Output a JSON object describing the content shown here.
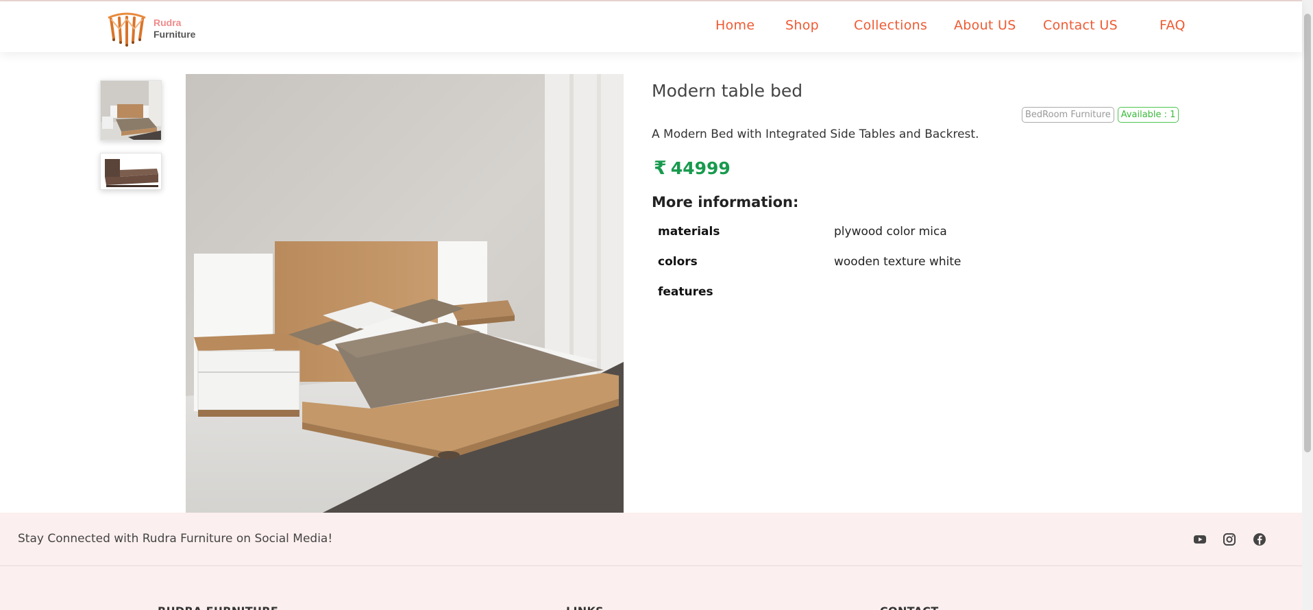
{
  "brand": {
    "line1": "Rudra",
    "line2": "Furniture"
  },
  "nav": {
    "items": [
      {
        "label": "Home"
      },
      {
        "label": "Shop"
      },
      {
        "label": "Collections"
      },
      {
        "label": "About US"
      },
      {
        "label": "Contact US"
      },
      {
        "label": "FAQ"
      }
    ]
  },
  "product": {
    "title": "Modern table bed",
    "category_badge": "BedRoom Furniture",
    "availability_badge": "Available : 1",
    "description": "A Modern Bed with Integrated Side Tables and Backrest.",
    "currency_symbol": "₹",
    "price": "44999",
    "more_info_heading": "More information:",
    "info": [
      {
        "key": "materials",
        "value": "plywood color mica"
      },
      {
        "key": "colors",
        "value": "wooden texture white"
      },
      {
        "key": "features",
        "value": ""
      }
    ]
  },
  "social_bar": {
    "text": "Stay Connected with Rudra Furniture on Social Media!",
    "icons": [
      "youtube-icon",
      "instagram-icon",
      "facebook-icon"
    ]
  },
  "footer": {
    "columns": [
      {
        "title": "RUDRA FURNITURE"
      },
      {
        "title": "LINKS"
      },
      {
        "title": "CONTACT"
      }
    ]
  },
  "colors": {
    "nav_link": "#ee5a32",
    "price": "#189a4e",
    "available_badge": "#3aba3a",
    "footer_bg": "#fcefef"
  }
}
